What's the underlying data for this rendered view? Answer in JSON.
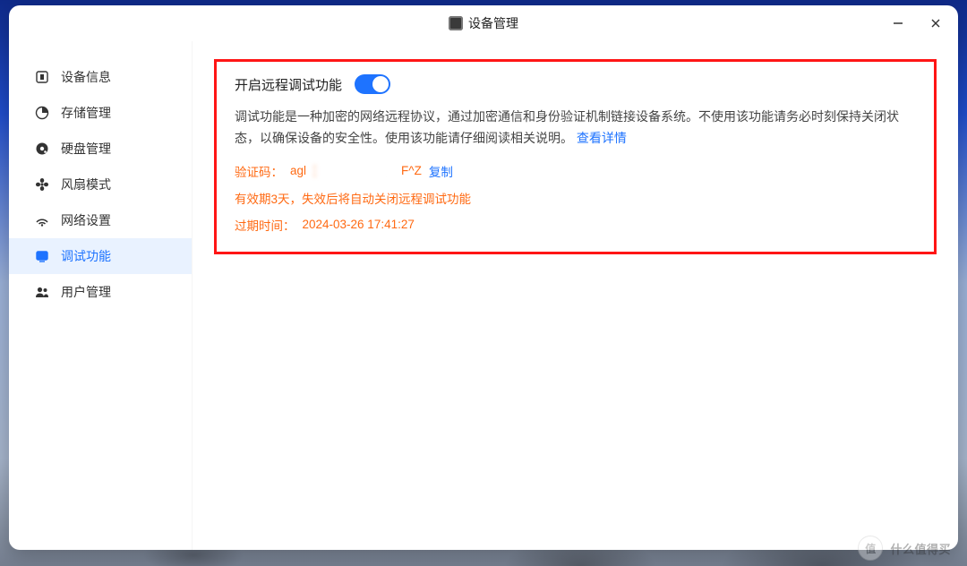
{
  "window": {
    "title": "设备管理"
  },
  "sidebar": {
    "items": [
      {
        "icon": "info",
        "label": "设备信息"
      },
      {
        "icon": "storage",
        "label": "存储管理"
      },
      {
        "icon": "disk",
        "label": "硬盘管理"
      },
      {
        "icon": "fan",
        "label": "风扇模式"
      },
      {
        "icon": "network",
        "label": "网络设置"
      },
      {
        "icon": "debug",
        "label": "调试功能",
        "active": true
      },
      {
        "icon": "users",
        "label": "用户管理"
      }
    ]
  },
  "main": {
    "toggle_label": "开启远程调试功能",
    "toggle_on": true,
    "description_part1": "调试功能是一种加密的网络远程协议，通过加密通信和身份验证机制链接设备系统。不使用该功能请务必时刻保持关闭状态，以确保设备的安全性。使用该功能请仔细阅读相关说明。",
    "description_link": "查看详情",
    "code_label": "验证码：",
    "code_prefix": "agl",
    "code_suffix": "F^Z",
    "copy_label": "复制",
    "validity": "有效期3天，失效后将自动关闭远程调试功能",
    "expire_label": "过期时间：",
    "expire_value": "2024-03-26 17:41:27"
  },
  "watermark": {
    "badge": "值",
    "text": "什么值得买"
  }
}
